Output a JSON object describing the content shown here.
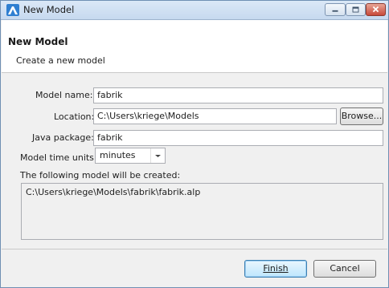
{
  "window": {
    "title": "New Model"
  },
  "header": {
    "title": "New Model",
    "subtitle": "Create a new model"
  },
  "form": {
    "model_name": {
      "label": "Model name:",
      "value": "fabrik"
    },
    "location": {
      "label": "Location:",
      "value": "C:\\Users\\kriege\\Models",
      "browse_label": "Browse..."
    },
    "java_package": {
      "label": "Java package:",
      "value": "fabrik"
    },
    "time_units": {
      "label": "Model time units:",
      "selected": "minutes"
    },
    "output": {
      "label": "The following model will be created:",
      "path": "C:\\Users\\kriege\\Models\\fabrik\\fabrik.alp"
    }
  },
  "buttons": {
    "finish": "Finish",
    "cancel": "Cancel"
  },
  "icons": {
    "app": "anylogic-app-icon",
    "minimize": "minimize-icon",
    "maximize": "maximize-icon",
    "close": "close-icon",
    "dropdown": "chevron-down-icon"
  }
}
